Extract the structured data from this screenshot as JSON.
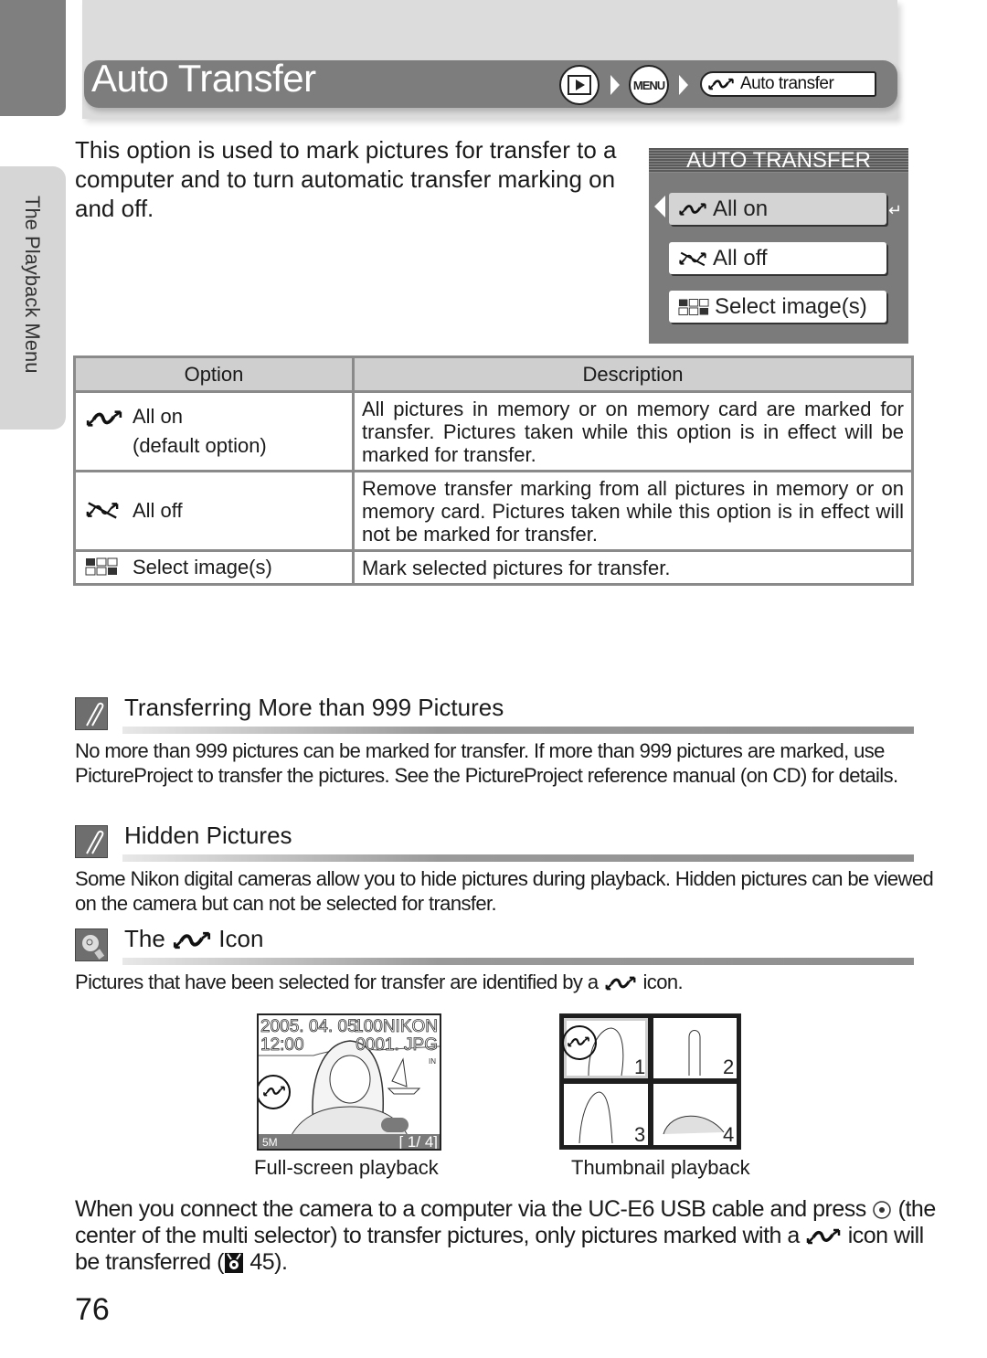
{
  "header": {
    "title": "Auto Transfer",
    "breadcrumb": {
      "step1_icon": "playback-icon",
      "step2_label": "MENU",
      "step3_icon": "auto-transfer-icon",
      "step3_label": "Auto transfer"
    }
  },
  "sidebar": {
    "section_label": "The Playback Menu"
  },
  "intro": "This option is used to mark pictures for transfer to a computer and to turn automatic transfer marking on and off.",
  "camera_menu": {
    "title": "AUTO TRANSFER",
    "items": [
      {
        "icon": "transfer-on-icon",
        "label": "All on",
        "selected": true
      },
      {
        "icon": "transfer-off-icon",
        "label": "All off",
        "selected": false
      },
      {
        "icon": "select-images-icon",
        "label": "Select image(s)",
        "selected": false
      }
    ]
  },
  "options_table": {
    "headers": [
      "Option",
      "Description"
    ],
    "rows": [
      {
        "icon": "transfer-on-icon",
        "option": "All on",
        "option_note": "(default option)",
        "description": "All pictures in memory or on memory card are marked for transfer. Pictures taken while this option is in effect will be marked for transfer."
      },
      {
        "icon": "transfer-off-icon",
        "option": "All off",
        "option_note": "",
        "description": "Remove transfer marking from all pictures in memory or on memory card. Pictures taken while this option is in effect will not be marked for transfer."
      },
      {
        "icon": "select-images-icon",
        "option": "Select image(s)",
        "option_note": "",
        "description": "Mark selected pictures for transfer."
      }
    ]
  },
  "notes": [
    {
      "icon": "note-pencil-icon",
      "title": "Transferring More than 999 Pictures",
      "text": "No more than 999 pictures can be marked for transfer. If more than 999 pictures are marked, use PictureProject to transfer the pictures. See the PictureProject reference manual (on CD) for details."
    },
    {
      "icon": "note-pencil-icon",
      "title": "Hidden Pictures",
      "text": "Some Nikon digital cameras allow you to hide pictures during playback. Hidden pictures can be viewed on the camera but can not be selected for transfer."
    },
    {
      "icon": "tip-bulb-icon",
      "title_prefix": "The",
      "title_suffix": "Icon",
      "text_prefix": "Pictures that have been selected for transfer are identified by a",
      "text_suffix": "icon."
    }
  ],
  "screens": {
    "full": {
      "caption": "Full-screen playback",
      "date": "2005. 04. 05",
      "time": "12:00",
      "folder": "100NIKON",
      "file": "0001. JPG",
      "memory": "IN",
      "size": "5M",
      "counter": "[   1/   4]"
    },
    "thumb": {
      "caption": "Thumbnail playback",
      "numbers": [
        "1",
        "2",
        "3",
        "4"
      ]
    }
  },
  "final_text": {
    "part1": "When you connect the camera to a computer via the UC-E6 USB cable and press",
    "part2": "(the center of the multi selector) to transfer pictures, only pictures marked with a",
    "part3": "icon will be transferred (",
    "part4": "45)."
  },
  "page_number": "76"
}
